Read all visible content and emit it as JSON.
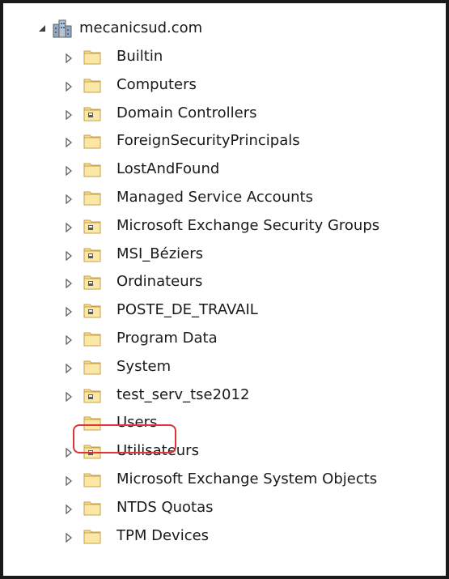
{
  "tree": {
    "root": {
      "label": "mecanicsud.com",
      "icon": "domain-icon",
      "expanded": true
    },
    "children": [
      {
        "label": "Builtin",
        "icon": "container-folder-icon"
      },
      {
        "label": "Computers",
        "icon": "container-folder-icon"
      },
      {
        "label": "Domain Controllers",
        "icon": "ou-folder-icon"
      },
      {
        "label": "ForeignSecurityPrincipals",
        "icon": "container-folder-icon"
      },
      {
        "label": "LostAndFound",
        "icon": "container-folder-icon"
      },
      {
        "label": "Managed Service Accounts",
        "icon": "container-folder-icon"
      },
      {
        "label": "Microsoft Exchange Security Groups",
        "icon": "ou-folder-icon"
      },
      {
        "label": "MSI_Béziers",
        "icon": "ou-folder-icon"
      },
      {
        "label": "Ordinateurs",
        "icon": "ou-folder-icon"
      },
      {
        "label": "POSTE_DE_TRAVAIL",
        "icon": "ou-folder-icon"
      },
      {
        "label": "Program Data",
        "icon": "container-folder-icon"
      },
      {
        "label": "System",
        "icon": "container-folder-icon"
      },
      {
        "label": "test_serv_tse2012",
        "icon": "ou-folder-icon"
      },
      {
        "label": "Users",
        "icon": "container-folder-icon",
        "no_expander": true,
        "highlighted": true
      },
      {
        "label": "Utilisateurs",
        "icon": "ou-folder-icon"
      },
      {
        "label": "Microsoft Exchange System Objects",
        "icon": "container-folder-icon"
      },
      {
        "label": "NTDS Quotas",
        "icon": "container-folder-icon"
      },
      {
        "label": "TPM Devices",
        "icon": "container-folder-icon"
      }
    ]
  },
  "colors": {
    "highlight_border": "#e0323a",
    "folder_fill": "#f7dc8f",
    "folder_edge": "#c9a24a"
  }
}
